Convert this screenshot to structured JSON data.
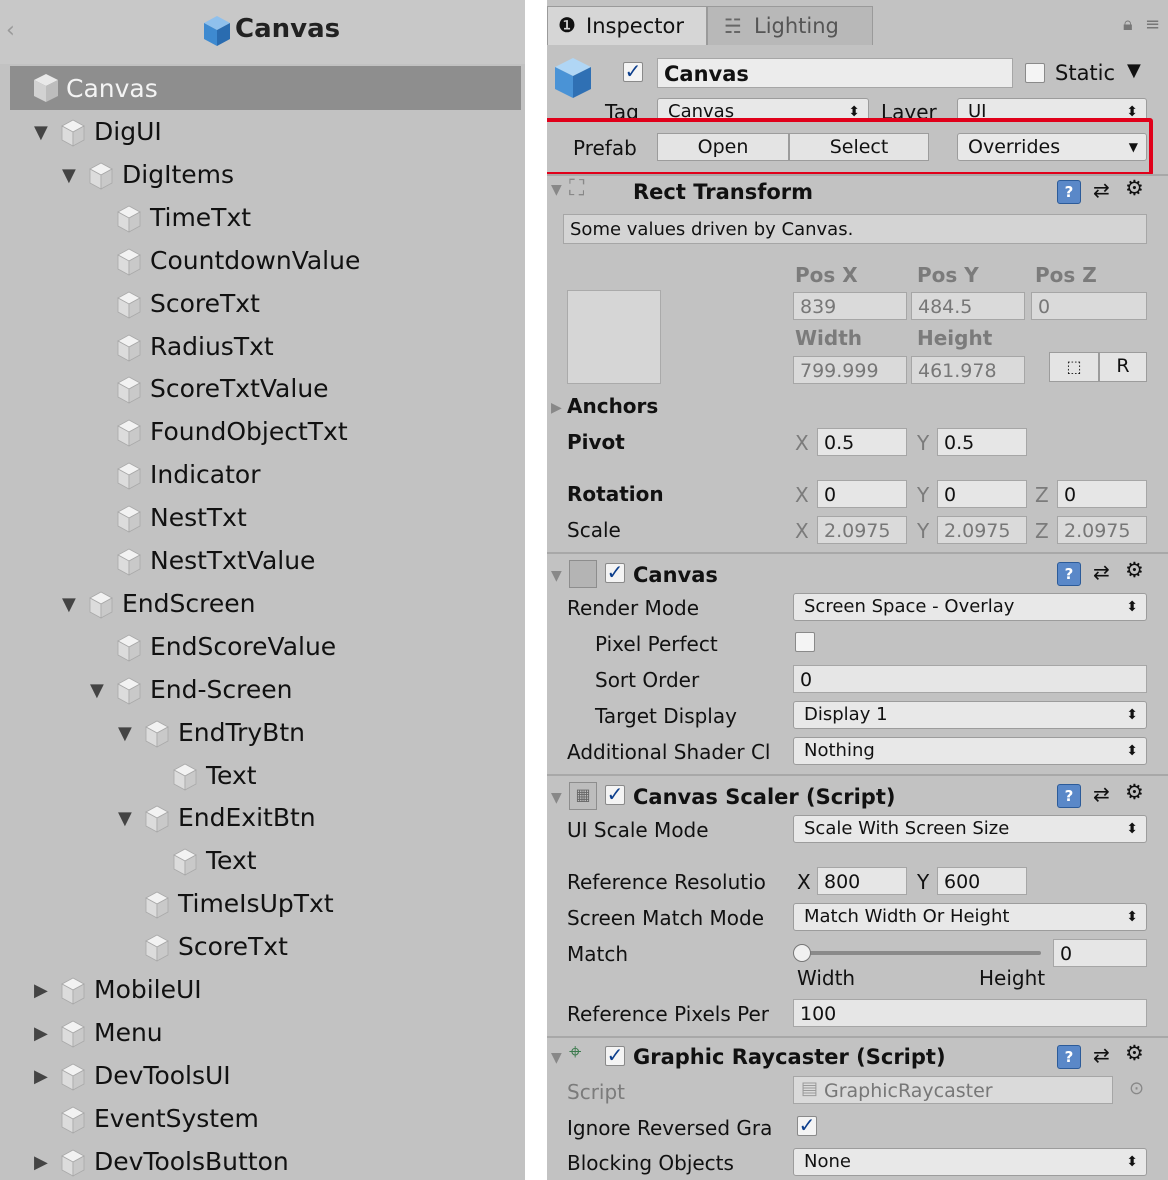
{
  "hierarchy": {
    "title": "Canvas",
    "selected": "Canvas",
    "items": [
      {
        "label": "DigUI",
        "depth": 0,
        "arrow": "down"
      },
      {
        "label": "DigItems",
        "depth": 1,
        "arrow": "down"
      },
      {
        "label": "TimeTxt",
        "depth": 2,
        "arrow": ""
      },
      {
        "label": "CountdownValue",
        "depth": 2,
        "arrow": ""
      },
      {
        "label": "ScoreTxt",
        "depth": 2,
        "arrow": ""
      },
      {
        "label": "RadiusTxt",
        "depth": 2,
        "arrow": ""
      },
      {
        "label": "ScoreTxtValue",
        "depth": 2,
        "arrow": ""
      },
      {
        "label": "FoundObjectTxt",
        "depth": 2,
        "arrow": ""
      },
      {
        "label": "Indicator",
        "depth": 2,
        "arrow": ""
      },
      {
        "label": "NestTxt",
        "depth": 2,
        "arrow": ""
      },
      {
        "label": "NestTxtValue",
        "depth": 2,
        "arrow": ""
      },
      {
        "label": "EndScreen",
        "depth": 1,
        "arrow": "down"
      },
      {
        "label": "EndScoreValue",
        "depth": 2,
        "arrow": ""
      },
      {
        "label": "End-Screen",
        "depth": 2,
        "arrow": "down"
      },
      {
        "label": "EndTryBtn",
        "depth": 3,
        "arrow": "down"
      },
      {
        "label": "Text",
        "depth": 4,
        "arrow": ""
      },
      {
        "label": "EndExitBtn",
        "depth": 3,
        "arrow": "down"
      },
      {
        "label": "Text",
        "depth": 4,
        "arrow": ""
      },
      {
        "label": "TimeIsUpTxt",
        "depth": 3,
        "arrow": ""
      },
      {
        "label": "ScoreTxt",
        "depth": 3,
        "arrow": ""
      },
      {
        "label": "MobileUI",
        "depth": 0,
        "arrow": "right"
      },
      {
        "label": "Menu",
        "depth": 0,
        "arrow": "right"
      },
      {
        "label": "DevToolsUI",
        "depth": 0,
        "arrow": "right"
      },
      {
        "label": "EventSystem",
        "depth": 0,
        "arrow": ""
      },
      {
        "label": "DevToolsButton",
        "depth": 0,
        "arrow": "right"
      }
    ]
  },
  "inspector": {
    "tabs": {
      "inspector": "Inspector",
      "lighting": "Lighting"
    },
    "header": {
      "name": "Canvas",
      "static_label": "Static",
      "tag_label": "Tag",
      "tag_value": "Canvas",
      "layer_label": "Layer",
      "layer_value": "UI",
      "prefab_label": "Prefab",
      "open_label": "Open",
      "select_label": "Select",
      "overrides_label": "Overrides"
    },
    "rect_transform": {
      "title": "Rect Transform",
      "note": "Some values driven by Canvas.",
      "pos_x_label": "Pos X",
      "pos_y_label": "Pos Y",
      "pos_z_label": "Pos Z",
      "pos_x": "839",
      "pos_y": "484.5",
      "pos_z": "0",
      "width_label": "Width",
      "height_label": "Height",
      "width": "799.999",
      "height": "461.978",
      "r_label": "R",
      "anchors_label": "Anchors",
      "pivot_label": "Pivot",
      "pivot_x": "0.5",
      "pivot_y": "0.5",
      "rotation_label": "Rotation",
      "rot_x": "0",
      "rot_y": "0",
      "rot_z": "0",
      "scale_label": "Scale",
      "scale_x": "2.0975",
      "scale_y": "2.0975",
      "scale_z": "2.0975",
      "x": "X",
      "y": "Y",
      "z": "Z"
    },
    "canvas": {
      "title": "Canvas",
      "render_mode_label": "Render Mode",
      "render_mode": "Screen Space - Overlay",
      "pixel_perfect_label": "Pixel Perfect",
      "sort_order_label": "Sort Order",
      "sort_order": "0",
      "target_display_label": "Target Display",
      "target_display": "Display 1",
      "shader_label": "Additional Shader Cl",
      "shader_value": "Nothing"
    },
    "scaler": {
      "title": "Canvas Scaler (Script)",
      "scale_mode_label": "UI Scale Mode",
      "scale_mode": "Scale With Screen Size",
      "ref_res_label": "Reference Resolutio",
      "ref_x": "800",
      "ref_y": "600",
      "match_mode_label": "Screen Match Mode",
      "match_mode": "Match Width Or Height",
      "match_label": "Match",
      "match_value": "0",
      "match_fraction": 0,
      "width_label": "Width",
      "height_label": "Height",
      "ref_pixels_label": "Reference Pixels Per",
      "ref_pixels": "100"
    },
    "raycaster": {
      "title": "Graphic Raycaster (Script)",
      "script_label": "Script",
      "script_value": "GraphicRaycaster",
      "ignore_label": "Ignore Reversed Gra",
      "blocking_label": "Blocking Objects",
      "blocking_value": "None"
    }
  },
  "colors": {
    "highlight": "#e0001a",
    "check": "#0c3e8c",
    "panel": "#c2c2c2"
  }
}
